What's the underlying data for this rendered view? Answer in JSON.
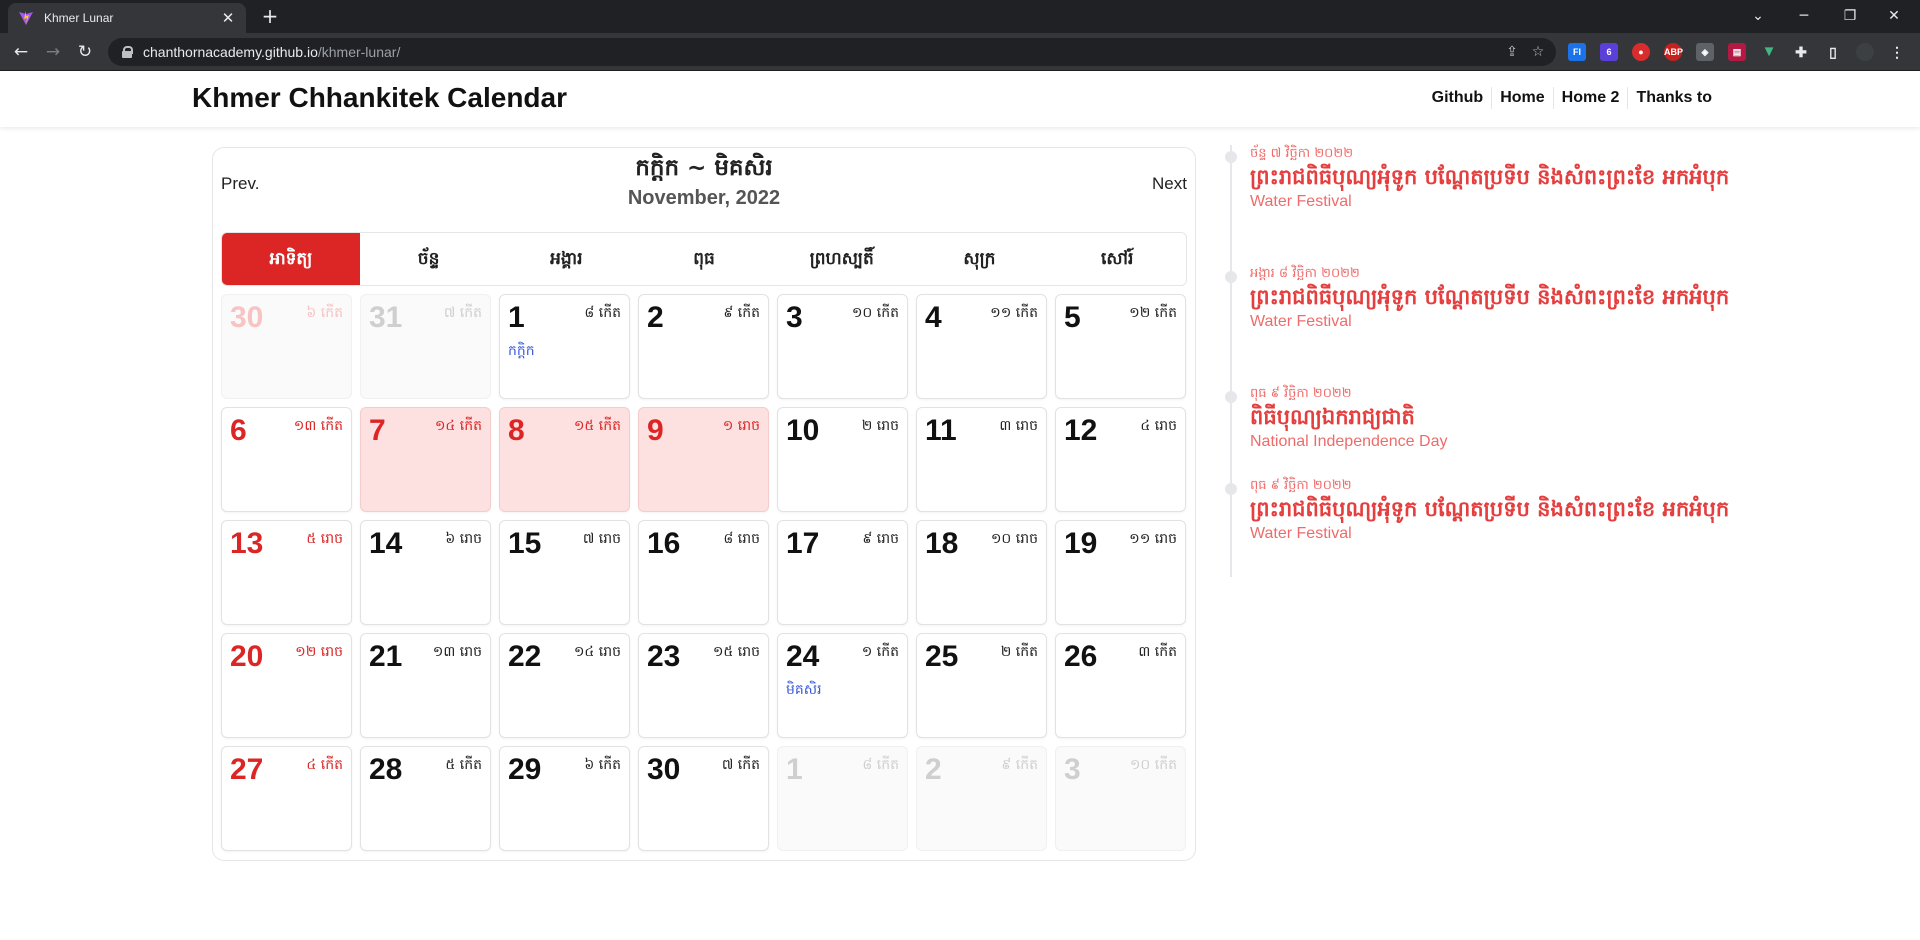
{
  "browser": {
    "tab_title": "Khmer Lunar",
    "url_host": "chanthornacademy.github.io",
    "url_path": "/khmer-lunar/"
  },
  "header": {
    "title": "Khmer Chhankitek Calendar",
    "nav": [
      "Github",
      "Home",
      "Home 2",
      "Thanks to"
    ]
  },
  "calendar": {
    "prev_label": "Prev.",
    "next_label": "Next",
    "khmer_month": "កក្តិក ~ មិគសិរ",
    "english_month": "November, 2022",
    "weekdays": [
      "អាទិត្យ",
      "ច័ន្ទ",
      "អង្គារ",
      "ពុធ",
      "ព្រហស្បតិ៍",
      "សុក្រ",
      "សៅរ៍"
    ],
    "days": [
      {
        "day": "30",
        "lunar": "៦ កើត",
        "type": "other"
      },
      {
        "day": "31",
        "lunar": "៧ កើត",
        "type": "other"
      },
      {
        "day": "1",
        "lunar": "៨ កើត",
        "type": "normal",
        "label": "កក្តិក"
      },
      {
        "day": "2",
        "lunar": "៩ កើត",
        "type": "normal"
      },
      {
        "day": "3",
        "lunar": "១០ កើត",
        "type": "normal"
      },
      {
        "day": "4",
        "lunar": "១១ កើត",
        "type": "normal"
      },
      {
        "day": "5",
        "lunar": "១២ កើត",
        "type": "normal"
      },
      {
        "day": "6",
        "lunar": "១៣ កើត",
        "type": "normal"
      },
      {
        "day": "7",
        "lunar": "១៤ កើត",
        "type": "holiday"
      },
      {
        "day": "8",
        "lunar": "១៥ កើត",
        "type": "holiday"
      },
      {
        "day": "9",
        "lunar": "១ រោច",
        "type": "holiday"
      },
      {
        "day": "10",
        "lunar": "២ រោច",
        "type": "normal"
      },
      {
        "day": "11",
        "lunar": "៣ រោច",
        "type": "normal"
      },
      {
        "day": "12",
        "lunar": "៤ រោច",
        "type": "normal"
      },
      {
        "day": "13",
        "lunar": "៥ រោច",
        "type": "normal"
      },
      {
        "day": "14",
        "lunar": "៦ រោច",
        "type": "normal"
      },
      {
        "day": "15",
        "lunar": "៧ រោច",
        "type": "normal"
      },
      {
        "day": "16",
        "lunar": "៨ រោច",
        "type": "normal"
      },
      {
        "day": "17",
        "lunar": "៩ រោច",
        "type": "normal"
      },
      {
        "day": "18",
        "lunar": "១០ រោច",
        "type": "normal"
      },
      {
        "day": "19",
        "lunar": "១១ រោច",
        "type": "normal"
      },
      {
        "day": "20",
        "lunar": "១២ រោច",
        "type": "normal"
      },
      {
        "day": "21",
        "lunar": "១៣ រោច",
        "type": "normal"
      },
      {
        "day": "22",
        "lunar": "១៤ រោច",
        "type": "normal"
      },
      {
        "day": "23",
        "lunar": "១៥ រោច",
        "type": "normal"
      },
      {
        "day": "24",
        "lunar": "១ កើត",
        "type": "normal",
        "label": "មិគសិរ"
      },
      {
        "day": "25",
        "lunar": "២ កើត",
        "type": "normal"
      },
      {
        "day": "26",
        "lunar": "៣ កើត",
        "type": "normal"
      },
      {
        "day": "27",
        "lunar": "៤ កើត",
        "type": "normal"
      },
      {
        "day": "28",
        "lunar": "៥ កើត",
        "type": "normal"
      },
      {
        "day": "29",
        "lunar": "៦ កើត",
        "type": "normal"
      },
      {
        "day": "30",
        "lunar": "៧ កើត",
        "type": "normal"
      },
      {
        "day": "1",
        "lunar": "៨ កើត",
        "type": "other"
      },
      {
        "day": "2",
        "lunar": "៩ កើត",
        "type": "other"
      },
      {
        "day": "3",
        "lunar": "១០ កើត",
        "type": "other"
      }
    ]
  },
  "events": [
    {
      "date": "ច័ន្ទ ៧ វិច្ឆិកា ២០២២",
      "title": "ព្រះរាជពិធីបុណ្យអុំទូក បណ្តែតប្រទីប និងសំពះព្រះខែ អកអំបុក",
      "subtitle": "Water Festival"
    },
    {
      "date": "អង្គារ ៨ វិច្ឆិកា ២០២២",
      "title": "ព្រះរាជពិធីបុណ្យអុំទូក បណ្តែតប្រទីប និងសំពះព្រះខែ អកអំបុក",
      "subtitle": "Water Festival"
    },
    {
      "date": "ពុធ ៩ វិច្ឆិកា ២០២២",
      "title": "ពិធីបុណ្យឯករាជ្យជាតិ",
      "subtitle": "National Independence Day"
    },
    {
      "date": "ពុធ ៩ វិច្ឆិកា ២០២២",
      "title": "ព្រះរាជពិធីបុណ្យអុំទូក បណ្តែតប្រទីប និងសំពះព្រះខែ អកអំបុក",
      "subtitle": "Water Festival"
    }
  ],
  "colors": {
    "accent_red": "#dc2626",
    "holiday_bg": "#fde0e0",
    "month_label_blue": "#3b5bdb"
  }
}
